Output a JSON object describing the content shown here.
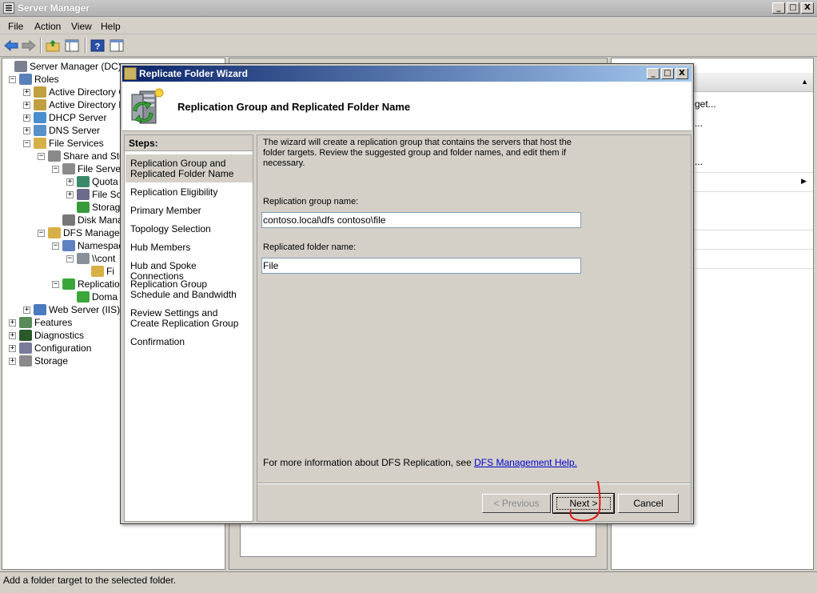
{
  "window": {
    "title": "Server Manager",
    "buttons": [
      "_",
      "□",
      "X"
    ]
  },
  "menu": [
    "File",
    "Action",
    "View",
    "Help"
  ],
  "toolbar": {
    "buttons": [
      "back-arrow-icon",
      "forward-arrow-icon",
      "up-folder-icon",
      "show-hide-tree-icon",
      "help-icon",
      "show-hide-action-pane-icon"
    ]
  },
  "tree": [
    {
      "label": "Server Manager (DC)",
      "icon": "server-manager-icon",
      "expander": ""
    },
    {
      "label": "Roles",
      "icon": "roles-icon",
      "expander": "−"
    },
    {
      "label": "Active Directory C",
      "icon": "active-directory-icon",
      "expander": "+"
    },
    {
      "label": "Active Directory D",
      "icon": "active-directory-icon",
      "expander": "+"
    },
    {
      "label": "DHCP Server",
      "icon": "dhcp-icon",
      "expander": "+"
    },
    {
      "label": "DNS Server",
      "icon": "dns-icon",
      "expander": "+"
    },
    {
      "label": "File Services",
      "icon": "file-services-icon",
      "expander": "−"
    },
    {
      "label": "Share and Sto",
      "icon": "share-storage-icon",
      "expander": "−"
    },
    {
      "label": "File Serve",
      "icon": "file-server-icon",
      "expander": "−"
    },
    {
      "label": "Quota",
      "icon": "quota-icon",
      "expander": "+"
    },
    {
      "label": "File Sc",
      "icon": "file-screen-icon",
      "expander": "+"
    },
    {
      "label": "Storag",
      "icon": "storage-report-icon",
      "expander": ""
    },
    {
      "label": "Disk Mana",
      "icon": "disk-management-icon",
      "expander": ""
    },
    {
      "label": "DFS Managem",
      "icon": "dfs-management-icon",
      "expander": "−"
    },
    {
      "label": "Namespac",
      "icon": "namespace-icon",
      "expander": "−"
    },
    {
      "label": "\\\\cont",
      "icon": "namespace-root-icon",
      "expander": "−"
    },
    {
      "label": "Fi",
      "icon": "folder-icon",
      "expander": ""
    },
    {
      "label": "Replicatio",
      "icon": "replication-icon",
      "expander": "−"
    },
    {
      "label": "Doma",
      "icon": "domain-icon",
      "expander": ""
    },
    {
      "label": "Web Server (IIS)",
      "icon": "web-server-icon",
      "expander": "+"
    },
    {
      "label": "Features",
      "icon": "features-icon",
      "expander": "+"
    },
    {
      "label": "Diagnostics",
      "icon": "diagnostics-icon",
      "expander": "+"
    },
    {
      "label": "Configuration",
      "icon": "configuration-icon",
      "expander": "+"
    },
    {
      "label": "Storage",
      "icon": "storage-icon",
      "expander": "+"
    }
  ],
  "right_pane": {
    "items": [
      "get...",
      "...",
      "..."
    ]
  },
  "status": "Add a folder target to the selected folder.",
  "dialog": {
    "title": "Replicate Folder Wizard",
    "header": "Replication Group and Replicated Folder Name",
    "steps_label": "Steps:",
    "steps": [
      "Replication Group and Replicated Folder Name",
      "Replication Eligibility",
      "Primary Member",
      "Topology Selection",
      "Hub Members",
      "Hub and Spoke Connections",
      "Replication Group Schedule and Bandwidth",
      "Review Settings and Create Replication Group",
      "Confirmation"
    ],
    "intro": "The wizard will create a replication group that contains the servers that host the folder targets. Review the suggested group and folder names, and edit them if necessary.",
    "group_label": "Replication group name:",
    "group_value": "contoso.local\\dfs contoso\\file",
    "folder_label": "Replicated folder name:",
    "folder_value": "File",
    "help_prefix": "For more information about DFS Replication, see ",
    "help_link": "DFS Management Help.",
    "buttons": {
      "previous": "< Previous",
      "next": "Next >",
      "cancel": "Cancel"
    }
  }
}
